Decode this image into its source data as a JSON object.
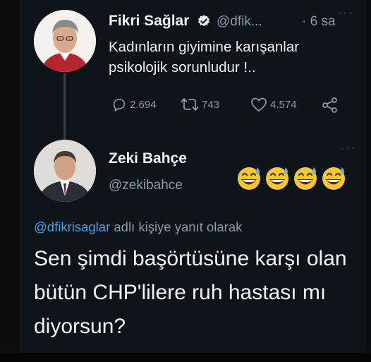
{
  "original_tweet": {
    "author_name": "Fikri Sağlar",
    "handle": "@dfik...",
    "time": "· 6 sa",
    "text_line1": "Kadınların giyimine karışanlar",
    "text_line2": "psikolojik sorunludur !..",
    "replies": "2.694",
    "retweets": "743",
    "likes": "4.574"
  },
  "reply_user": {
    "author_name": "Zeki Bahçe",
    "handle": "@zekibahce"
  },
  "reply": {
    "context_mention": "@dfikrisaglar",
    "context_suffix": " adlı kişiye yanıt olarak",
    "text": "Sen şimdi başörtüsüne karşı olan bütün CHP'lilere ruh hastası mı diyorsun?"
  },
  "icons": {
    "verified": "verified-badge-icon",
    "reply": "reply-icon",
    "retweet": "retweet-icon",
    "like": "heart-icon",
    "share": "share-icon",
    "more": "more-icon",
    "emoji": "grinning-sweat-emoji-icon"
  },
  "colors": {
    "background": "#0f1419",
    "mention": "#4c9fe3",
    "verified": "#1d9bf0",
    "secondary_text": "#8b98a5"
  }
}
